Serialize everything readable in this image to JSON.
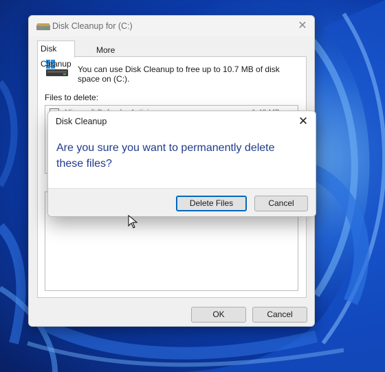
{
  "main_window": {
    "title": "Disk Cleanup for  (C:)",
    "tabs": [
      {
        "label": "Disk Cleanup",
        "active": true
      },
      {
        "label": "More Options",
        "active": false
      }
    ],
    "info_text": "You can use Disk Cleanup to free up to 10.7 MB of disk space on  (C:).",
    "files_to_delete_label": "Files to delete:",
    "file_rows": [
      {
        "label": "Microsoft Defender Antivirus",
        "size": "1.48 MB",
        "checked": false
      }
    ],
    "truncated_label": "T",
    "ok_label": "OK",
    "cancel_label": "Cancel"
  },
  "confirm_dialog": {
    "title": "Disk Cleanup",
    "question": "Are you sure you want to permanently delete these files?",
    "delete_label": "Delete Files",
    "cancel_label": "Cancel"
  },
  "colors": {
    "accent": "#0067c0",
    "question_text": "#1f3a8c",
    "wallpaper": "#0b3aa8"
  },
  "icons": {
    "app": "disk-cleanup-icon",
    "drive": "drive-icon",
    "close": "close-icon",
    "cursor": "mouse-pointer-icon"
  }
}
